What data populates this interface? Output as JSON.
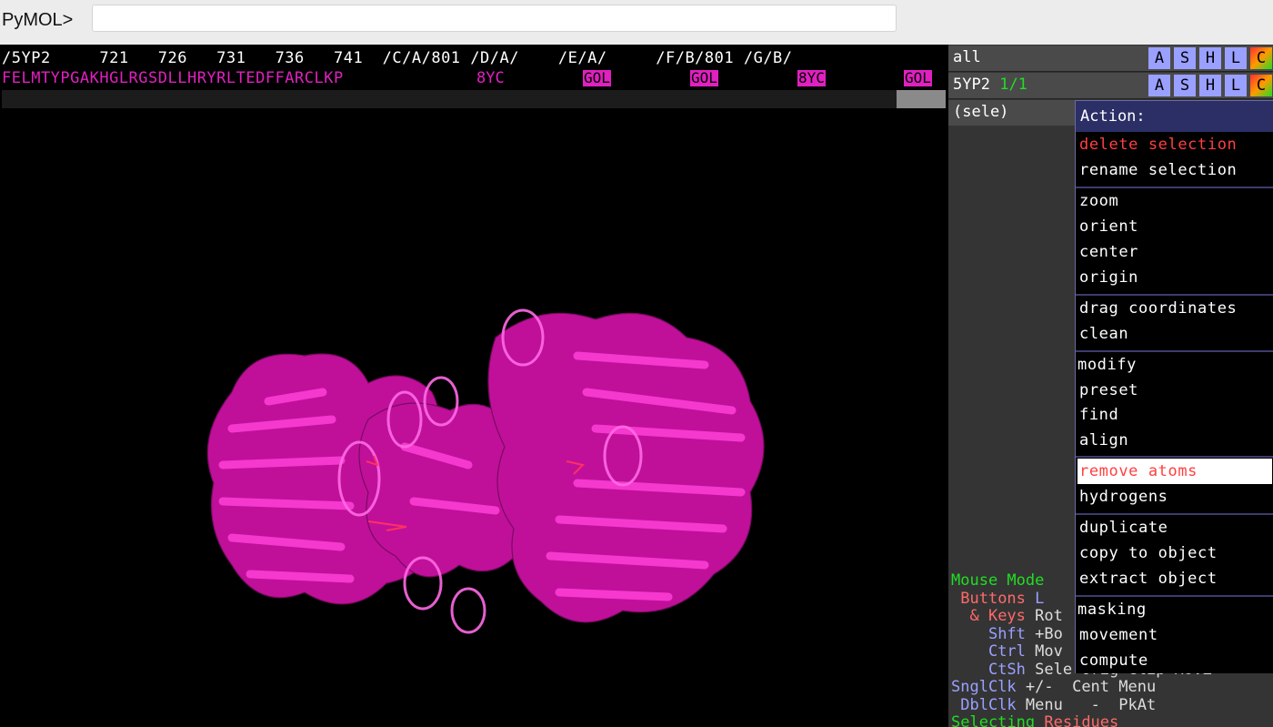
{
  "app": {
    "prompt": "PyMOL>",
    "command_value": ""
  },
  "sequence": {
    "numbers_line": "/5YP2     721   726   731   736   741  /C/A/801 /D/A/    /E/A/     /F/B/801 /G/B/",
    "residues_line": "FELMTYPGAKHGLRGSDLLHRYRLTEDFFARCLKP",
    "hetero": [
      "8YC",
      "GOL",
      "GOL",
      "8YC",
      "GOL"
    ]
  },
  "objects": [
    {
      "name": "all",
      "frames": "",
      "buttons": [
        "A",
        "S",
        "H",
        "L",
        "C"
      ]
    },
    {
      "name": "5YP2",
      "frames": "1/1",
      "buttons": [
        "A",
        "S",
        "H",
        "L",
        "C"
      ]
    }
  ],
  "selection": {
    "name": "(sele)"
  },
  "mouse_mode": {
    "title": "Mouse Mode",
    "buttons": "Buttons",
    "buttons_tail": "L",
    "keys": "& Keys",
    "keys_tail": "Rot",
    "shft": "Shft",
    "shft_tail": "+Bo",
    "ctrl": "Ctrl",
    "ctrl_tail": "Mov",
    "ctsh": "CtSh",
    "ctsh_tail": "Sele Orig Clip MovZ",
    "sngl": "SnglClk",
    "sngl_tail": "+/-  Cent Menu",
    "dbl": "DblClk",
    "dbl_tail": "Menu   -  PkAt",
    "selecting": "Selecting",
    "selecting_what": "Residues"
  },
  "menu": {
    "title": "Action:",
    "groups": [
      [
        "delete selection",
        "rename selection"
      ],
      [
        "zoom",
        "orient",
        "center",
        "origin"
      ],
      [
        "drag coordinates",
        "clean"
      ],
      [
        "modify",
        "preset",
        "find",
        "align"
      ],
      [
        "remove atoms",
        "hydrogens"
      ],
      [
        "duplicate",
        "copy to object",
        "extract object"
      ],
      [
        "masking",
        "movement",
        "compute"
      ]
    ],
    "highlighted": "remove atoms"
  },
  "colors": {
    "magenta": "#e020c0",
    "mouse_title": "#22dd22",
    "panel_bg": "#343434"
  }
}
